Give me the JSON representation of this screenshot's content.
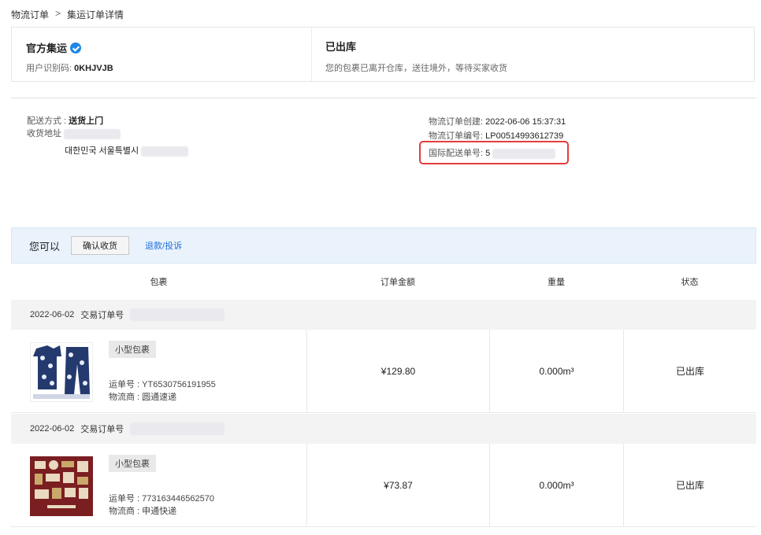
{
  "breadcrumb": {
    "parent": "物流订单",
    "separator": ">",
    "current": "集运订单详情"
  },
  "summary": {
    "title": "官方集运",
    "code_label": "用户识别码: ",
    "code_value": "0KHJVJB",
    "status": "已出库",
    "status_desc": "您的包裹已离开仓库，送往境外，等待买家收货"
  },
  "shipping": {
    "method_label": "配送方式 : ",
    "method_value": "送货上门",
    "address_label": "收货地址",
    "address_line2": "대한민국 서울특별시",
    "created_label": "物流订单创建: ",
    "created_value": "2022-06-06 15:37:31",
    "order_no_label": "物流订单编号: ",
    "order_no_value": "LP00514993612739",
    "intl_label": "国际配送单号: ",
    "intl_value": "5"
  },
  "actions": {
    "label": "您可以",
    "confirm": "确认收货",
    "refund": "退款/投诉"
  },
  "table": {
    "headers": [
      "包裹",
      "订单金额",
      "重量",
      "状态"
    ],
    "groups": [
      {
        "date": "2022-06-02",
        "trade_label": "交易订单号",
        "tag": "小型包裹",
        "tracking": "运单号 : YT6530756191955",
        "carrier": "物流商 : 圆通速递",
        "amount": "¥129.80",
        "weight": "0.000m³",
        "status": "已出库"
      },
      {
        "date": "2022-06-02",
        "trade_label": "交易订单号",
        "tag": "小型包裹",
        "tracking": "运单号 : 773163446562570",
        "carrier": "物流商 : 申通快递",
        "amount": "¥73.87",
        "weight": "0.000m³",
        "status": "已出库"
      }
    ]
  },
  "colors": {
    "accent": "#1e6fd9",
    "highlight_frame": "#e43c3c",
    "action_bg": "#eaf3fc"
  }
}
